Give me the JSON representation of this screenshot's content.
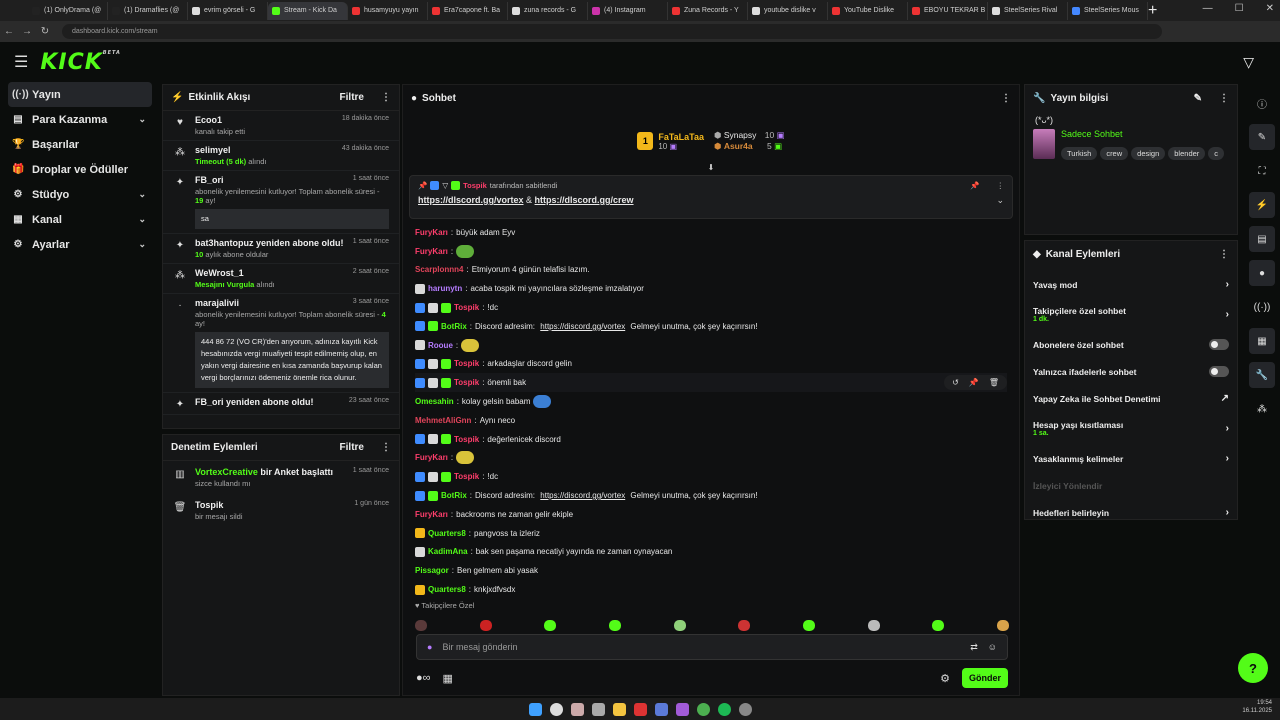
{
  "browser": {
    "tabs": [
      {
        "label": "(1) OnlyDrama (@",
        "color": "#222"
      },
      {
        "label": "(1) Dramaflies (@",
        "color": "#222"
      },
      {
        "label": "evrim görseli - G",
        "color": "#ddd"
      },
      {
        "label": "Stream - Kick Da",
        "color": "#53fc18"
      },
      {
        "label": "husamyuyu yayın",
        "color": "#e33"
      },
      {
        "label": "Era7capone ft. Ba",
        "color": "#e33"
      },
      {
        "label": "zuna records - G",
        "color": "#ddd"
      },
      {
        "label": "(4) Instagram",
        "color": "#c3a"
      },
      {
        "label": "Zuna Records - Y",
        "color": "#e33"
      },
      {
        "label": "youtube dislike v",
        "color": "#ddd"
      },
      {
        "label": "YouTube Dislike",
        "color": "#e33"
      },
      {
        "label": "EBOYU TEKRAR B",
        "color": "#e33"
      },
      {
        "label": "SteelSeries Rival",
        "color": "#ddd"
      },
      {
        "label": "SteelSeries Mous",
        "color": "#48f"
      }
    ],
    "url": "dashboard.kick.com/stream"
  },
  "header": {
    "logo": "KICK",
    "logo_beta": "BETA"
  },
  "sidebar": {
    "items": [
      {
        "label": "Yayın",
        "icon": "broadcast-icon",
        "glyph": "((·))"
      },
      {
        "label": "Para Kazanma",
        "icon": "wallet-icon",
        "glyph": "▤"
      },
      {
        "label": "Başarılar",
        "icon": "trophy-icon",
        "glyph": "🏆"
      },
      {
        "label": "Droplar ve Ödüller",
        "icon": "gift-icon",
        "glyph": "🎁"
      },
      {
        "label": "Stüdyo",
        "icon": "studio-icon",
        "glyph": "⚙"
      },
      {
        "label": "Kanal",
        "icon": "channel-icon",
        "glyph": "▦"
      },
      {
        "label": "Ayarlar",
        "icon": "settings-icon",
        "glyph": "⚙"
      }
    ]
  },
  "activity": {
    "title": "Etkinlik Akışı",
    "filter": "Filtre",
    "events": [
      {
        "name": "Ecoo1",
        "time": "18 dakika önce",
        "sub": "kanalı takip etti"
      },
      {
        "name": "selimyel",
        "time": "43 dakika önce",
        "highlight": "Timeout (5 dk)",
        "sub": " alındı"
      },
      {
        "name": "FB_ori",
        "time": "1 saat önce",
        "sub": "abonelik yenilemesini kutluyor! Toplam abonelik süresi - ",
        "highlight": "19",
        "sub2": " ay!",
        "box": "sa"
      },
      {
        "name": "bat3hantopuz yeniden abone oldu!",
        "time": "1 saat önce",
        "highlight": "10",
        "sub": " aylık abone oldular"
      },
      {
        "name": "WeWrost_1",
        "time": "2 saat önce",
        "highlight": "Mesajını Vurgula",
        "sub": " alındı"
      },
      {
        "name": "marajalivii",
        "time": "3 saat önce",
        "sub": "abonelik yenilemesini kutluyor! Toplam abonelik süresi - ",
        "highlight": "4",
        "sub2": " ay!",
        "box": "444 86 72 (VO CR)'den arıyorum, adınıza kayıtlı Kick hesabınızda vergi muafiyeti tespit edilmemiş olup, en yakın vergi dairesine en kısa zamanda başvurup kalan vergi borçlarınızı ödemeniz önemle rica olunur."
      },
      {
        "name": "FB_ori yeniden abone oldu!",
        "time": "23 saat önce"
      }
    ]
  },
  "moderation": {
    "title": "Denetim Eylemleri",
    "filter": "Filtre",
    "events": [
      {
        "name": "VortexCreative",
        "action": " bir Anket başlattı",
        "sub": "sizce kullandı mı",
        "time": "1 saat önce"
      },
      {
        "name": "Tospik",
        "sub": "bir mesajı sildi",
        "time": "1 gün önce"
      }
    ]
  },
  "chat": {
    "title": "Sohbet",
    "podium": {
      "first": {
        "name": "FaTaLaTaa",
        "count": "10"
      },
      "second": {
        "name": "Synapsy",
        "count": "10"
      },
      "third": {
        "name": "Asur4a",
        "count": "5"
      }
    },
    "pinned": {
      "by_user": "Tospik",
      "by_text": " tarafından sabitlendi",
      "link1": "https://dlscord.gg/vortex",
      "amp": " & ",
      "link2": "https://dlscord.gg/crew"
    },
    "messages": [
      {
        "user": "FuryKarı",
        "color": "#ff3e6c",
        "text": "büyük adam Eyv"
      },
      {
        "user": "FuryKarı",
        "color": "#ff3e6c",
        "text": "",
        "emote": "#5fae3a"
      },
      {
        "user": "Scarplonnn4",
        "color": "#e0445a",
        "text": "Etmiyorum 4 günün telafisi lazım."
      },
      {
        "user": "harunytn",
        "color": "#b57cff",
        "text": "acaba tospik mi yayıncılara sözleşme imzalatıyor",
        "badges": [
          "#d9d9d9"
        ]
      },
      {
        "user": "Tospik",
        "color": "#ff3e6c",
        "text": "!dc",
        "badges": [
          "#3f8cff",
          "#d9d9d9",
          "#53fc18"
        ]
      },
      {
        "user": "BotRix",
        "color": "#53fc18",
        "text": "Discord adresim: ",
        "link": "https://discord.gg/vortex",
        "after": " Gelmeyi unutma, çok şey kaçırırsın!",
        "badges": [
          "#3f8cff",
          "#53fc18"
        ]
      },
      {
        "user": "Rooue",
        "color": "#b57cff",
        "text": "",
        "emote": "#d9c33a",
        "badges": [
          "#d9d9d9"
        ]
      },
      {
        "user": "Tospik",
        "color": "#ff3e6c",
        "text": "arkadaşlar discord gelin",
        "badges": [
          "#3f8cff",
          "#d9d9d9",
          "#53fc18"
        ]
      },
      {
        "user": "Tospik",
        "color": "#ff3e6c",
        "text": "önemli bak",
        "badges": [
          "#3f8cff",
          "#d9d9d9",
          "#53fc18"
        ],
        "hover": true
      },
      {
        "user": "Omesahin",
        "color": "#53fc18",
        "text": "kolay gelsin babam",
        "emote": "#3b7fd4"
      },
      {
        "user": "MehmetAliGnn",
        "color": "#e0445a",
        "text": "Aynı neco"
      },
      {
        "user": "Tospik",
        "color": "#ff3e6c",
        "text": "değerlenicek discord",
        "badges": [
          "#3f8cff",
          "#d9d9d9",
          "#53fc18"
        ]
      },
      {
        "user": "FuryKarı",
        "color": "#ff3e6c",
        "text": "",
        "emote": "#d9c33a"
      },
      {
        "user": "Tospik",
        "color": "#ff3e6c",
        "text": "!dc",
        "badges": [
          "#3f8cff",
          "#d9d9d9",
          "#53fc18"
        ]
      },
      {
        "user": "BotRix",
        "color": "#53fc18",
        "text": "Discord adresim: ",
        "link": "https://discord.gg/vortex",
        "after": " Gelmeyi unutma, çok şey kaçırırsın!",
        "badges": [
          "#3f8cff",
          "#53fc18"
        ]
      },
      {
        "user": "FuryKarı",
        "color": "#ff3e6c",
        "text": "backrooms ne zaman gelir ekiple"
      },
      {
        "user": "Quarters8",
        "color": "#53fc18",
        "text": "pangvoss ta izleriz",
        "badges": [
          "#f3b81a"
        ]
      },
      {
        "user": "KadimAna",
        "color": "#53fc18",
        "text": "bak sen paşama necatiyi yayında ne zaman oynayacan",
        "badges": [
          "#d9d9d9"
        ]
      },
      {
        "user": "Pissagor",
        "color": "#53fc18",
        "text": "Ben gelmem abi yasak"
      },
      {
        "user": "Quarters8",
        "color": "#53fc18",
        "text": "knkjxdfvsdx",
        "badges": [
          "#f3b81a"
        ]
      }
    ],
    "followers_only": "Takipçilere Özel",
    "placeholder": "Bir mesaj gönderin",
    "send": "Gönder"
  },
  "stream_info": {
    "title": "Yayın bilgisi",
    "emoticon": "(*ᴗ*)",
    "category": "Sadece Sohbet",
    "tags": [
      "Turkish",
      "crew",
      "design",
      "blender",
      "c"
    ]
  },
  "channel_actions": {
    "title": "Kanal Eylemleri",
    "items": [
      {
        "label": "Yavaş mod",
        "type": "arrow"
      },
      {
        "label": "Takipçilere özel sohbet",
        "sub": "1 dk.",
        "type": "arrow"
      },
      {
        "label": "Abonelere özel sohbet",
        "type": "toggle"
      },
      {
        "label": "Yalnızca ifadelerle sohbet",
        "type": "toggle"
      },
      {
        "label": "Yapay Zeka ile Sohbet Denetimi",
        "type": "ext"
      },
      {
        "label": "Hesap yaşı kısıtlaması",
        "sub": "1 sa.",
        "type": "arrow"
      },
      {
        "label": "Yasaklanmış kelimeler",
        "type": "arrow"
      },
      {
        "label": "İzleyici Yönlendir",
        "type": "disabled"
      },
      {
        "label": "Hedefleri belirleyin",
        "type": "arrow"
      }
    ]
  },
  "taskbar": {
    "time": "19:54",
    "date": "16.11.2025"
  }
}
